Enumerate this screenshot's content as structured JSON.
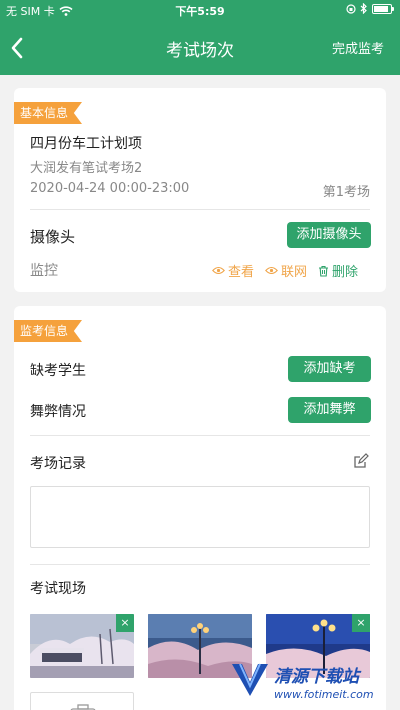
{
  "status_bar": {
    "carrier": "无 SIM 卡",
    "time": "下午5:59"
  },
  "nav": {
    "title": "考试场次",
    "done_label": "完成监考"
  },
  "basic_info": {
    "tag": "基本信息",
    "plan_name": "四月份车工计划项",
    "venue": "大润发有笔试考场2",
    "datetime": "2020-04-24 00:00-23:00",
    "room_no": "第1考场",
    "camera_label": "摄像头",
    "add_camera_label": "添加摄像头",
    "monitor_label": "监控",
    "actions": {
      "view": "查看",
      "network": "联网",
      "delete": "删除"
    }
  },
  "proctor_info": {
    "tag": "监考信息",
    "absent_label": "缺考学生",
    "add_absent_label": "添加缺考",
    "cheat_label": "舞弊情况",
    "add_cheat_label": "添加舞弊",
    "record_label": "考场记录",
    "record_value": "",
    "scene_label": "考试现场",
    "photo_close": "×"
  },
  "watermark": {
    "name": "清源下载站",
    "url": "www.fotimeit.com"
  },
  "colors": {
    "primary": "#2fa36b",
    "tag": "#f5a13c",
    "action_orange": "#f0a54a"
  }
}
